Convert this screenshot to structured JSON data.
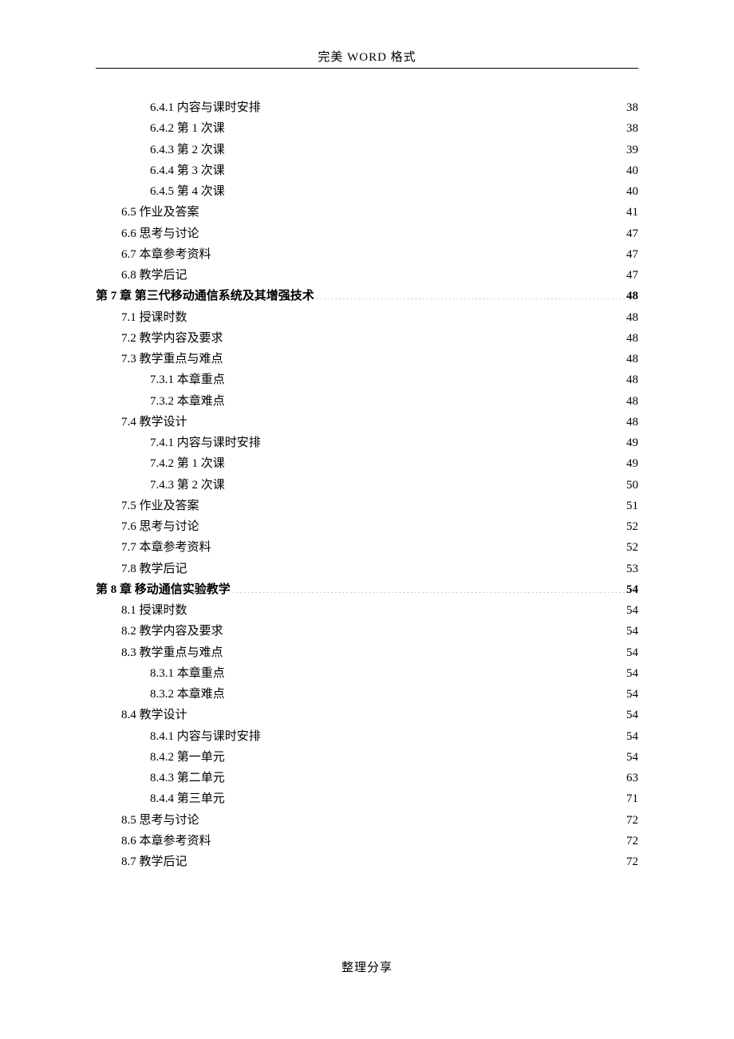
{
  "header": "完美 WORD 格式",
  "footer": "整理分享",
  "toc": [
    {
      "level": 3,
      "bold": false,
      "label": "6.4.1  内容与课时安排",
      "page": "38"
    },
    {
      "level": 3,
      "bold": false,
      "label": "6.4.2  第 1 次课",
      "page": "38"
    },
    {
      "level": 3,
      "bold": false,
      "label": "6.4.3  第 2 次课",
      "page": "39"
    },
    {
      "level": 3,
      "bold": false,
      "label": "6.4.4  第 3 次课",
      "page": "40"
    },
    {
      "level": 3,
      "bold": false,
      "label": "6.4.5  第 4 次课",
      "page": "40"
    },
    {
      "level": 2,
      "bold": false,
      "label": "6.5  作业及答案",
      "page": "41"
    },
    {
      "level": 2,
      "bold": false,
      "label": "6.6  思考与讨论",
      "page": "47"
    },
    {
      "level": 2,
      "bold": false,
      "label": "6.7  本章参考资料",
      "page": "47"
    },
    {
      "level": 2,
      "bold": false,
      "label": "6.8  教学后记",
      "page": "47"
    },
    {
      "level": 1,
      "bold": true,
      "label": "第  7  章  第三代移动通信系统及其增强技术 ",
      "page": "48"
    },
    {
      "level": 2,
      "bold": false,
      "label": "7.1  授课时数",
      "page": "48"
    },
    {
      "level": 2,
      "bold": false,
      "label": "7.2  教学内容及要求",
      "page": "48"
    },
    {
      "level": 2,
      "bold": false,
      "label": "7.3  教学重点与难点",
      "page": "48"
    },
    {
      "level": 3,
      "bold": false,
      "label": "7.3.1  本章重点",
      "page": "48"
    },
    {
      "level": 3,
      "bold": false,
      "label": "7.3.2  本章难点",
      "page": "48"
    },
    {
      "level": 2,
      "bold": false,
      "label": "7.4  教学设计",
      "page": "48"
    },
    {
      "level": 3,
      "bold": false,
      "label": "7.4.1  内容与课时安排",
      "page": "49"
    },
    {
      "level": 3,
      "bold": false,
      "label": "7.4.2  第 1 次课",
      "page": "49"
    },
    {
      "level": 3,
      "bold": false,
      "label": "7.4.3  第 2 次课",
      "page": "50"
    },
    {
      "level": 2,
      "bold": false,
      "label": "7.5  作业及答案",
      "page": "51"
    },
    {
      "level": 2,
      "bold": false,
      "label": "7.6  思考与讨论",
      "page": "52"
    },
    {
      "level": 2,
      "bold": false,
      "label": "7.7  本章参考资料",
      "page": "52"
    },
    {
      "level": 2,
      "bold": false,
      "label": "7.8  教学后记",
      "page": "53"
    },
    {
      "level": 1,
      "bold": true,
      "label": "第  8  章  移动通信实验教学 ",
      "page": "54"
    },
    {
      "level": 2,
      "bold": false,
      "label": "8.1  授课时数",
      "page": "54"
    },
    {
      "level": 2,
      "bold": false,
      "label": "8.2  教学内容及要求",
      "page": "54"
    },
    {
      "level": 2,
      "bold": false,
      "label": "8.3  教学重点与难点",
      "page": "54"
    },
    {
      "level": 3,
      "bold": false,
      "label": "8.3.1  本章重点",
      "page": "54"
    },
    {
      "level": 3,
      "bold": false,
      "label": "8.3.2  本章难点",
      "page": "54"
    },
    {
      "level": 2,
      "bold": false,
      "label": "8.4  教学设计",
      "page": "54"
    },
    {
      "level": 3,
      "bold": false,
      "label": "8.4.1  内容与课时安排",
      "page": "54"
    },
    {
      "level": 3,
      "bold": false,
      "label": "8.4.2  第一单元",
      "page": "54"
    },
    {
      "level": 3,
      "bold": false,
      "label": "8.4.3  第二单元",
      "page": "63"
    },
    {
      "level": 3,
      "bold": false,
      "label": "8.4.4  第三单元",
      "page": "71"
    },
    {
      "level": 2,
      "bold": false,
      "label": "8.5  思考与讨论",
      "page": "72"
    },
    {
      "level": 2,
      "bold": false,
      "label": "8.6  本章参考资料",
      "page": "72"
    },
    {
      "level": 2,
      "bold": false,
      "label": "8.7  教学后记",
      "page": "72"
    }
  ]
}
